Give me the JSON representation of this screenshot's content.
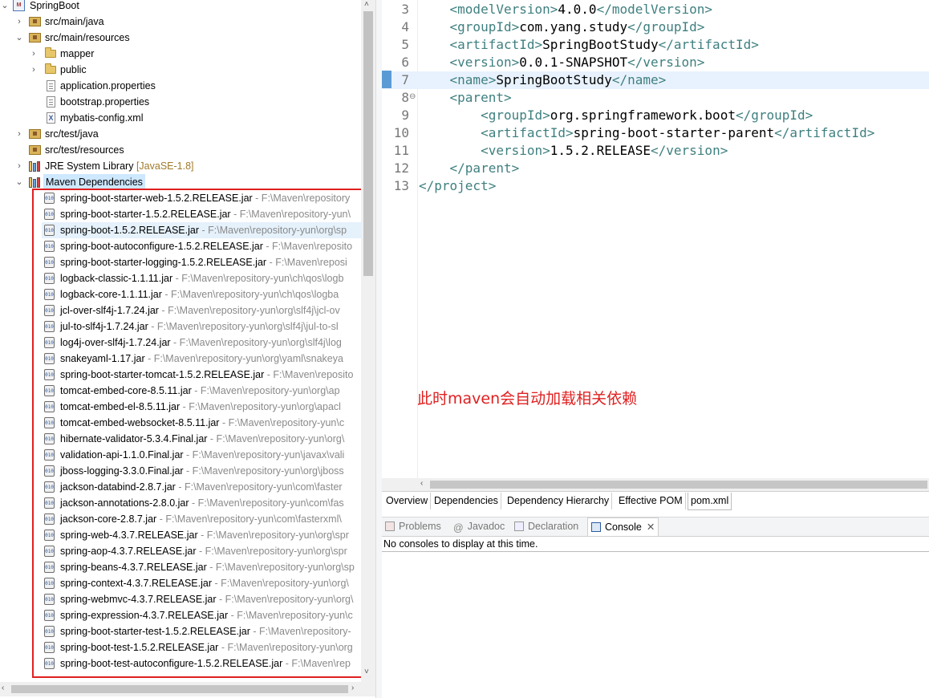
{
  "tree": {
    "project": "SpringBoot",
    "src_main_java": "src/main/java",
    "src_main_resources": "src/main/resources",
    "mapper": "mapper",
    "public": "public",
    "application_properties": "application.properties",
    "bootstrap_properties": "bootstrap.properties",
    "mybatis_config": "mybatis-config.xml",
    "src_test_java": "src/test/java",
    "src_test_resources": "src/test/resources",
    "jre": "JRE System Library",
    "jre_suffix": "[JavaSE-1.8]",
    "maven_deps": "Maven Dependencies",
    "jars": [
      {
        "name": "spring-boot-starter-web-1.5.2.RELEASE.jar",
        "path": "- F:\\Maven\\repository"
      },
      {
        "name": "spring-boot-starter-1.5.2.RELEASE.jar",
        "path": "- F:\\Maven\\repository-yun\\"
      },
      {
        "name": "spring-boot-1.5.2.RELEASE.jar",
        "path": "- F:\\Maven\\repository-yun\\org\\sp"
      },
      {
        "name": "spring-boot-autoconfigure-1.5.2.RELEASE.jar",
        "path": "- F:\\Maven\\reposito"
      },
      {
        "name": "spring-boot-starter-logging-1.5.2.RELEASE.jar",
        "path": "- F:\\Maven\\reposi"
      },
      {
        "name": "logback-classic-1.1.11.jar",
        "path": "- F:\\Maven\\repository-yun\\ch\\qos\\logb"
      },
      {
        "name": "logback-core-1.1.11.jar",
        "path": "- F:\\Maven\\repository-yun\\ch\\qos\\logba"
      },
      {
        "name": "jcl-over-slf4j-1.7.24.jar",
        "path": "- F:\\Maven\\repository-yun\\org\\slf4j\\jcl-ov"
      },
      {
        "name": "jul-to-slf4j-1.7.24.jar",
        "path": "- F:\\Maven\\repository-yun\\org\\slf4j\\jul-to-sl"
      },
      {
        "name": "log4j-over-slf4j-1.7.24.jar",
        "path": "- F:\\Maven\\repository-yun\\org\\slf4j\\log"
      },
      {
        "name": "snakeyaml-1.17.jar",
        "path": "- F:\\Maven\\repository-yun\\org\\yaml\\snakeya"
      },
      {
        "name": "spring-boot-starter-tomcat-1.5.2.RELEASE.jar",
        "path": "- F:\\Maven\\reposito"
      },
      {
        "name": "tomcat-embed-core-8.5.11.jar",
        "path": "- F:\\Maven\\repository-yun\\org\\ap"
      },
      {
        "name": "tomcat-embed-el-8.5.11.jar",
        "path": "- F:\\Maven\\repository-yun\\org\\apacl"
      },
      {
        "name": "tomcat-embed-websocket-8.5.11.jar",
        "path": "- F:\\Maven\\repository-yun\\c"
      },
      {
        "name": "hibernate-validator-5.3.4.Final.jar",
        "path": "- F:\\Maven\\repository-yun\\org\\"
      },
      {
        "name": "validation-api-1.1.0.Final.jar",
        "path": "- F:\\Maven\\repository-yun\\javax\\vali"
      },
      {
        "name": "jboss-logging-3.3.0.Final.jar",
        "path": "- F:\\Maven\\repository-yun\\org\\jboss"
      },
      {
        "name": "jackson-databind-2.8.7.jar",
        "path": "- F:\\Maven\\repository-yun\\com\\faster"
      },
      {
        "name": "jackson-annotations-2.8.0.jar",
        "path": "- F:\\Maven\\repository-yun\\com\\fas"
      },
      {
        "name": "jackson-core-2.8.7.jar",
        "path": "- F:\\Maven\\repository-yun\\com\\fasterxml\\"
      },
      {
        "name": "spring-web-4.3.7.RELEASE.jar",
        "path": "- F:\\Maven\\repository-yun\\org\\spr"
      },
      {
        "name": "spring-aop-4.3.7.RELEASE.jar",
        "path": "- F:\\Maven\\repository-yun\\org\\spr"
      },
      {
        "name": "spring-beans-4.3.7.RELEASE.jar",
        "path": "- F:\\Maven\\repository-yun\\org\\sp"
      },
      {
        "name": "spring-context-4.3.7.RELEASE.jar",
        "path": "- F:\\Maven\\repository-yun\\org\\"
      },
      {
        "name": "spring-webmvc-4.3.7.RELEASE.jar",
        "path": "- F:\\Maven\\repository-yun\\org\\"
      },
      {
        "name": "spring-expression-4.3.7.RELEASE.jar",
        "path": "- F:\\Maven\\repository-yun\\c"
      },
      {
        "name": "spring-boot-starter-test-1.5.2.RELEASE.jar",
        "path": "- F:\\Maven\\repository-"
      },
      {
        "name": "spring-boot-test-1.5.2.RELEASE.jar",
        "path": "- F:\\Maven\\repository-yun\\org"
      },
      {
        "name": "spring-boot-test-autoconfigure-1.5.2.RELEASE.jar",
        "path": "- F:\\Maven\\rep"
      }
    ],
    "selected_jar_index": 2
  },
  "editor": {
    "lines": [
      {
        "num": "3",
        "indent": "    ",
        "open": "<modelVersion>",
        "text": "4.0.0",
        "close": "</modelVersion>"
      },
      {
        "num": "4",
        "indent": "    ",
        "open": "<groupId>",
        "text": "com.yang.study",
        "close": "</groupId>"
      },
      {
        "num": "5",
        "indent": "    ",
        "open": "<artifactId>",
        "text": "SpringBootStudy",
        "close": "</artifactId>"
      },
      {
        "num": "6",
        "indent": "    ",
        "open": "<version>",
        "text": "0.0.1-SNAPSHOT",
        "close": "</version>"
      },
      {
        "num": "7",
        "indent": "    ",
        "open": "<name>",
        "text": "SpringBootStudy",
        "close": "</name>"
      },
      {
        "num": "8",
        "indent": "    ",
        "open": "<parent>",
        "text": "",
        "close": ""
      },
      {
        "num": "9",
        "indent": "        ",
        "open": "<groupId>",
        "text": "org.springframework.boot",
        "close": "</groupId>"
      },
      {
        "num": "10",
        "indent": "        ",
        "open": "<artifactId>",
        "text": "spring-boot-starter-parent",
        "close": "</artifactId>"
      },
      {
        "num": "11",
        "indent": "        ",
        "open": "<version>",
        "text": "1.5.2.RELEASE",
        "close": "</version>"
      },
      {
        "num": "12",
        "indent": "    ",
        "open": "</parent>",
        "text": "",
        "close": ""
      },
      {
        "num": "13",
        "indent": "",
        "open": "</project>",
        "text": "",
        "close": ""
      }
    ],
    "current_line_index": 4,
    "annotation": "此时maven会自动加载相关依赖",
    "annotation_color": "#e02020"
  },
  "editor_tabs": [
    "Overview",
    "Dependencies",
    "Dependency Hierarchy",
    "Effective POM",
    "pom.xml"
  ],
  "active_editor_tab": "pom.xml",
  "view_tabs": {
    "problems": "Problems",
    "javadoc": "Javadoc",
    "declaration": "Declaration",
    "console": "Console"
  },
  "console_message": "No consoles to display at this time.",
  "colors": {
    "tag": "#3f7f7f",
    "highlight_box": "#e02020",
    "selection": "#cde8ff"
  }
}
